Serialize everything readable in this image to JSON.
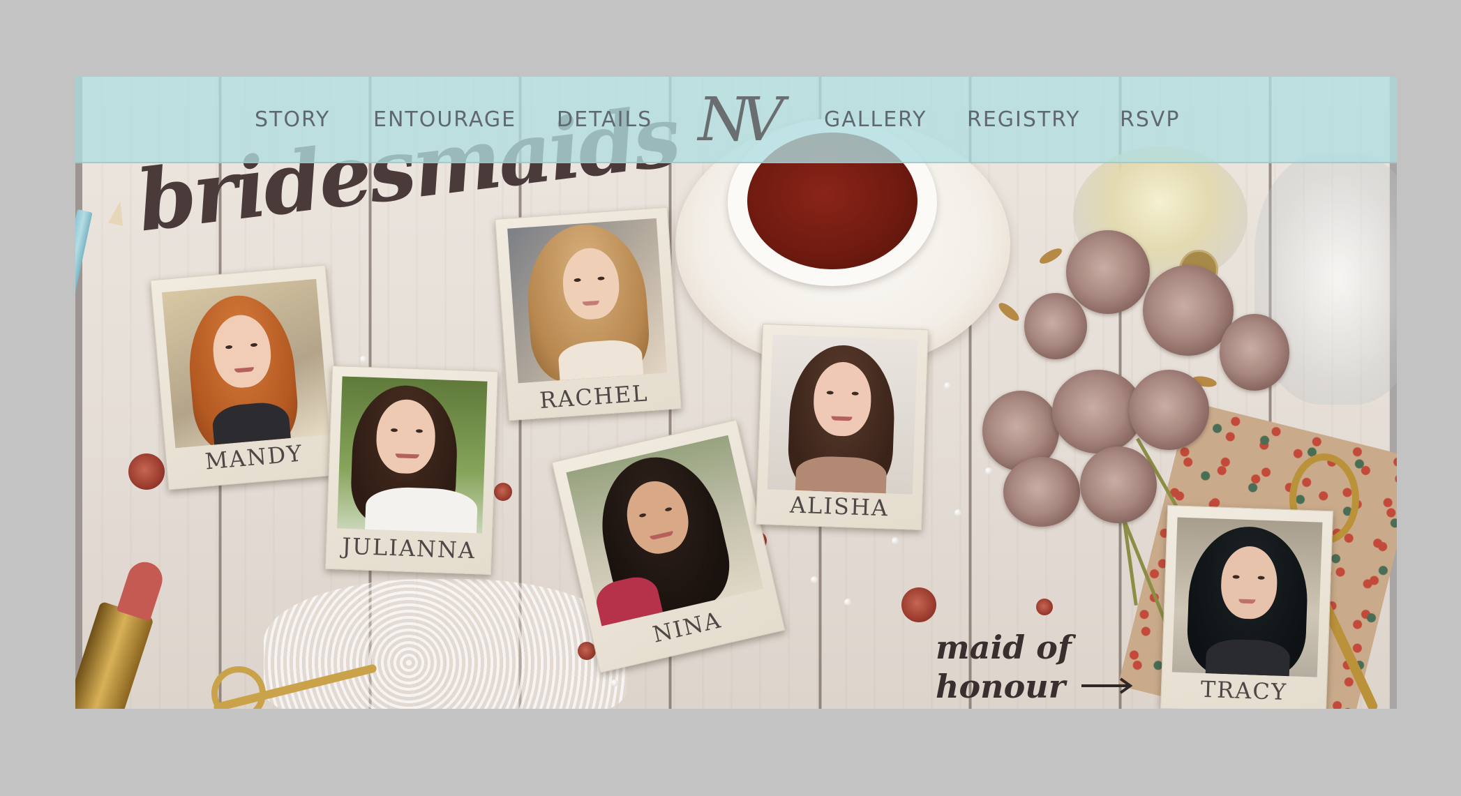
{
  "nav": {
    "left_items": [
      "STORY",
      "ENTOURAGE",
      "DETAILS"
    ],
    "logo": "NV",
    "right_items": [
      "GALLERY",
      "REGISTRY",
      "RSVP"
    ]
  },
  "section": {
    "title": "bridesmaids",
    "maid_of_honour": "maid of honour"
  },
  "bridesmaids": [
    {
      "name": "MANDY"
    },
    {
      "name": "JULIANNA"
    },
    {
      "name": "RACHEL"
    },
    {
      "name": "NINA"
    },
    {
      "name": "ALISHA"
    },
    {
      "name": "TRACY"
    }
  ],
  "colors": {
    "nav_band": "#b0dee0",
    "nav_text": "#5f6870",
    "background": "#c3c3c3",
    "script_text": "#4b3a3a"
  }
}
